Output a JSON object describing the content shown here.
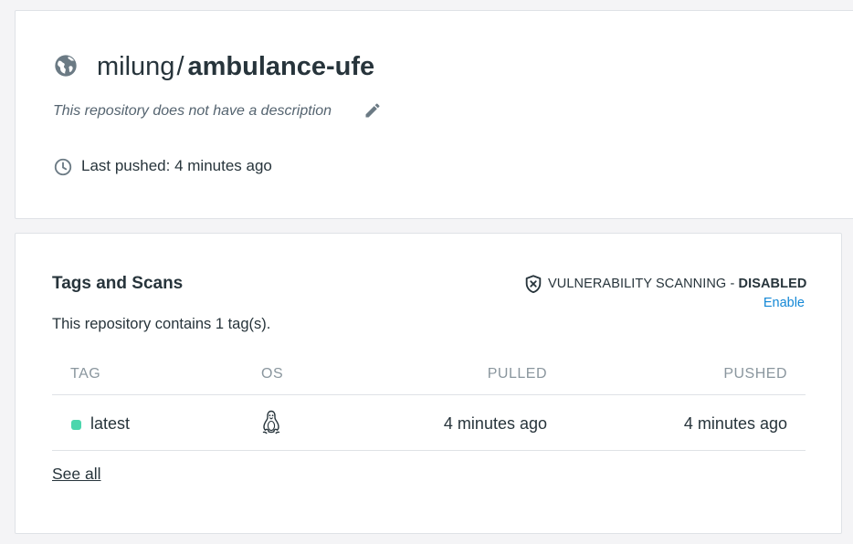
{
  "repo": {
    "namespace": "milung",
    "separator": "/",
    "name": "ambulance-ufe",
    "description": "This repository does not have a description",
    "last_pushed": "Last pushed: 4 minutes ago"
  },
  "tags_section": {
    "title": "Tags and Scans",
    "vuln_prefix": "VULNERABILITY SCANNING - ",
    "vuln_status": "DISABLED",
    "enable_label": "Enable",
    "summary": "This repository contains 1 tag(s).",
    "columns": {
      "tag": "TAG",
      "os": "OS",
      "pulled": "PULLED",
      "pushed": "PUSHED"
    },
    "rows": [
      {
        "tag": "latest",
        "os_icon": "linux-icon",
        "pulled": "4 minutes ago",
        "pushed": "4 minutes ago",
        "status_color": "#4cd6ad"
      }
    ],
    "see_all_label": "See all"
  },
  "icons": {
    "globe": "globe-icon",
    "edit": "pencil-icon",
    "clock": "clock-icon",
    "shield": "shield-x-icon"
  },
  "colors": {
    "link": "#1488d6",
    "tag_status": "#4cd6ad",
    "icon_gray": "#6b7a84"
  }
}
